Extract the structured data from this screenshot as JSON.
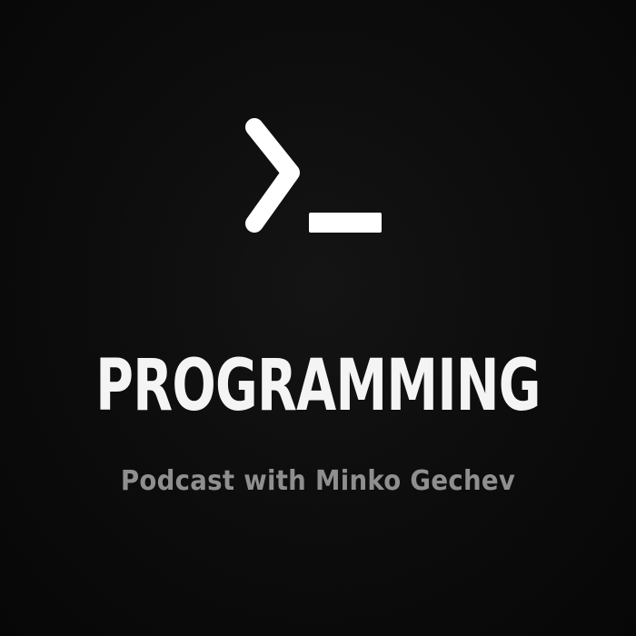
{
  "cover": {
    "title": "PROGRAMMING",
    "subtitle": "Podcast with Minko Gechev",
    "logo_icon": "terminal-prompt-icon"
  },
  "colors": {
    "background": "#0b0b0b",
    "title": "#f4f4f4",
    "subtitle": "#8f8f8f",
    "logo": "#ffffff"
  }
}
